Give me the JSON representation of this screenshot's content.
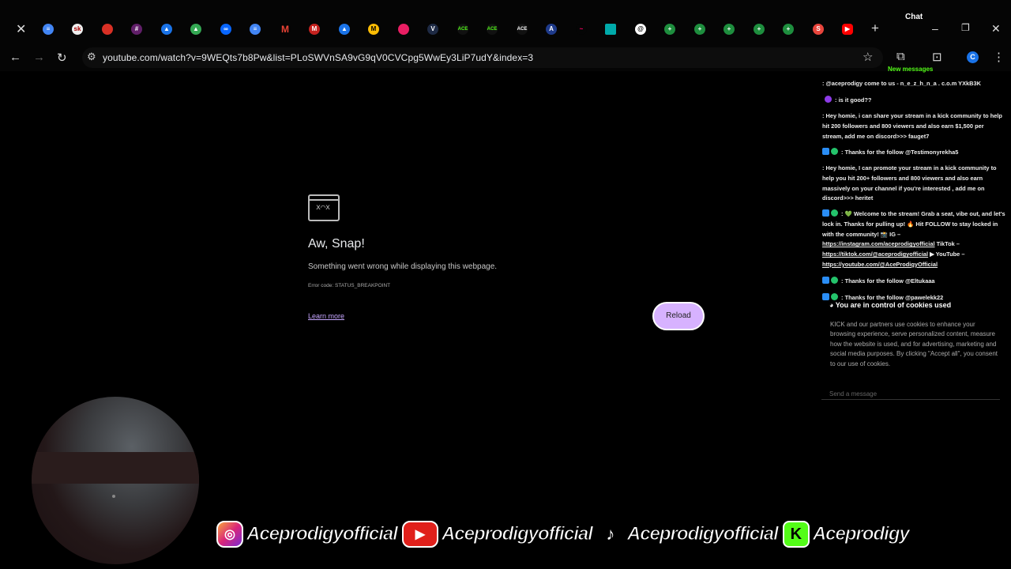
{
  "browser": {
    "url": "youtube.com/watch?v=9WEQts7b8Pw&list=PLoSWVnSA9vG9qV0CVCpg5WwEy3LiP7udY&index=3",
    "chat_window_title": "Chat"
  },
  "error_page": {
    "title": "Aw, Snap!",
    "description": "Something went wrong while displaying this webpage.",
    "error_code": "Error code: STATUS_BREAKPOINT",
    "learn_more": "Learn more",
    "reload": "Reload"
  },
  "chat": {
    "new_messages": "New messages",
    "messages": [
      {
        "text": ": @aceprodigy come to us - n_e_z_h_n_a . c.o.m YXkB3K"
      },
      {
        "text": " : is it good??"
      },
      {
        "text": ": Hey homie, i can share your stream in a kick community to help hit 200 followers and 800 viewers and also earn $1,500 per stream, add me on discord>>> fauget7"
      },
      {
        "text": " : Thanks for the follow @Testimonyrekha5"
      },
      {
        "text": ": Hey homie, I can promote your stream in a kick community to help you hit 200+ followers and 800 viewers and also earn massively on your channel if you're interested , add me on discord>>> heritet"
      },
      {
        "text": " : 💚 Welcome to the stream! Grab a seat, vibe out, and let's lock in. Thanks for pulling up! 🔥 Hit FOLLOW to stay locked in with the community! 📸 IG –",
        "link1": "https://instagram.com/aceprodigyofficial",
        "mid1": " TikTok –",
        "link2": "https://tiktok.com/@aceprodigyofficial",
        "mid2": " ▶ YouTube –",
        "link3": "https://youtube.com/@AceProdigyOfficial"
      },
      {
        "text": " : Thanks for the follow @Eltukaaa"
      },
      {
        "text": " : Thanks for the follow @pawelekk22"
      }
    ],
    "cookie_title": "You are in control of cookies used",
    "cookie_text": "KICK and our partners use cookies to enhance your browsing experience, serve personalized content, measure how the website is used, and for advertising, marketing and social media purposes. By clicking \"Accept all\", you consent to our use of cookies.",
    "send_placeholder": "Send a message"
  },
  "socials": {
    "instagram": "Aceprodigyofficial",
    "youtube": "Aceprodigyofficial",
    "tiktok": "Aceprodigyofficial",
    "kick": "Aceprodigy"
  },
  "colors": {
    "kick_green": "#53fc18",
    "reload_button": "#d7b2ff",
    "link_purple": "#c6a6ff"
  }
}
